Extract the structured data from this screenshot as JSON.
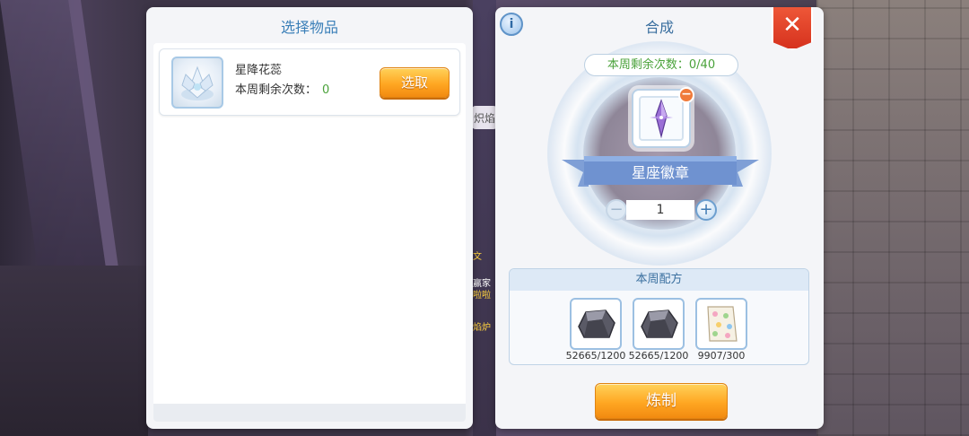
{
  "left_panel": {
    "title": "选择物品",
    "item": {
      "name": "星降花蕊",
      "count_label": "本周剩余次数：",
      "count_value": "0",
      "select_label": "选取",
      "icon": "crystal-flower-icon"
    }
  },
  "right_panel": {
    "title": "合成",
    "info_label": "i",
    "close_label": "✕",
    "remaining_label": "本周剩余次数：0/40",
    "target": {
      "name": "星座徽章",
      "icon": "star-crystal-icon"
    },
    "remove_label": "−",
    "quantity": "1",
    "minus_label": "−",
    "plus_label": "+",
    "recipe": {
      "title": "本周配方",
      "materials": [
        {
          "icon": "ore-stone-icon",
          "count": "52665/1200"
        },
        {
          "icon": "ore-stone-icon",
          "count": "52665/1200"
        },
        {
          "icon": "polka-dot-cloth-icon",
          "count": "9907/300"
        }
      ]
    },
    "craft_label": "炼制"
  },
  "background": {
    "peek_tab_text": "炽焰",
    "peek_texts": [
      "文",
      "赢家",
      "啦啦",
      "焰炉"
    ]
  },
  "colors": {
    "accent_blue": "#3a7fb8",
    "button_orange": "#ffa722",
    "count_green": "#4aa23a",
    "close_red": "#d6321e"
  }
}
